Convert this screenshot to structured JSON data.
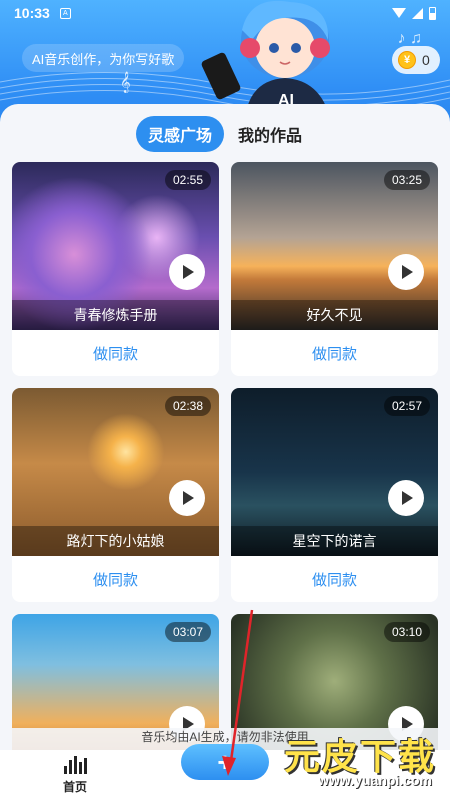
{
  "status_bar": {
    "time": "10:33",
    "app_icon": "A"
  },
  "header": {
    "tagline": "AI音乐创作，为你写好歌",
    "coins": "0",
    "coin_icon": "coin-icon"
  },
  "tabs": {
    "active": "灵感广场",
    "inactive": "我的作品"
  },
  "cards": [
    {
      "duration": "02:55",
      "title": "青春修炼手册",
      "action": "做同款"
    },
    {
      "duration": "03:25",
      "title": "好久不见",
      "action": "做同款"
    },
    {
      "duration": "02:38",
      "title": "路灯下的小姑娘",
      "action": "做同款"
    },
    {
      "duration": "02:57",
      "title": "星空下的诺言",
      "action": "做同款"
    },
    {
      "duration": "03:07",
      "title": "",
      "action": ""
    },
    {
      "duration": "03:10",
      "title": "",
      "action": ""
    }
  ],
  "notice": "音乐均由AI生成，请勿非法使用",
  "bottom_nav": {
    "home_label": "首页",
    "add_label": "+"
  },
  "watermark": {
    "title": "元皮下载",
    "url": "www.yuanpi.com"
  },
  "colors": {
    "accent": "#2d8ff0",
    "header": "#3a9bf7"
  }
}
